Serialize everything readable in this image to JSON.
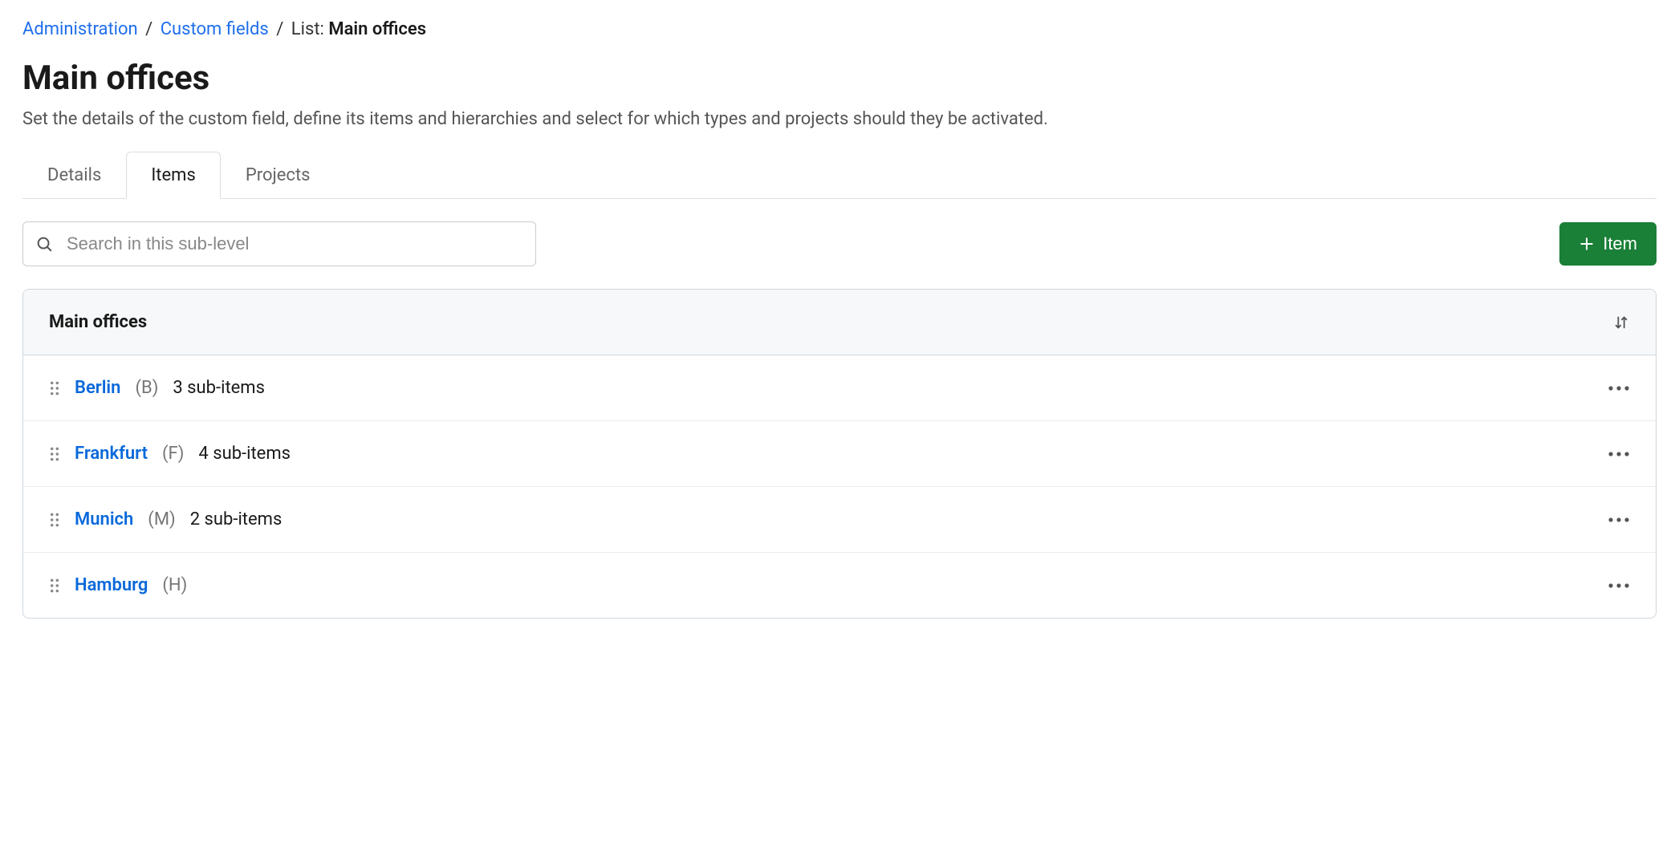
{
  "breadcrumb": {
    "administration": "Administration",
    "custom_fields": "Custom fields",
    "list_prefix": "List:",
    "list_name": "Main offices"
  },
  "header": {
    "title": "Main offices",
    "description": "Set the details of the custom field, define its items and hierarchies and select for which types and projects should they be activated."
  },
  "tabs": {
    "details": "Details",
    "items": "Items",
    "projects": "Projects"
  },
  "search": {
    "placeholder": "Search in this sub-level"
  },
  "actions": {
    "add_item": "Item"
  },
  "panel": {
    "title": "Main offices"
  },
  "items": [
    {
      "name": "Berlin",
      "code": "(B)",
      "sub": "3 sub-items"
    },
    {
      "name": "Frankfurt",
      "code": "(F)",
      "sub": "4 sub-items"
    },
    {
      "name": "Munich",
      "code": "(M)",
      "sub": "2 sub-items"
    },
    {
      "name": "Hamburg",
      "code": "(H)",
      "sub": ""
    }
  ]
}
